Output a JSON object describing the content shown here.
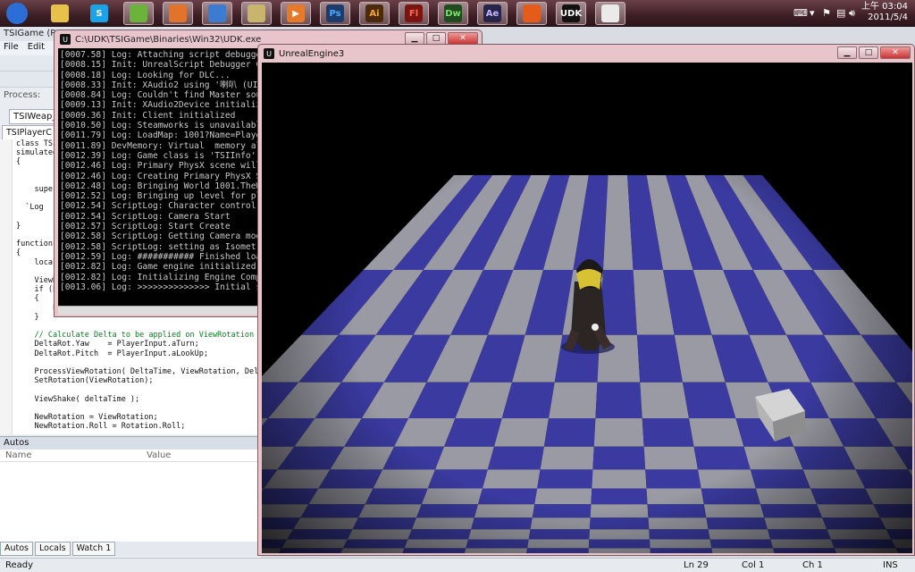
{
  "taskbar": {
    "apps": [
      {
        "name": "start",
        "label": ""
      },
      {
        "name": "explorer",
        "label": ""
      },
      {
        "name": "skype",
        "label": "S"
      },
      {
        "name": "contacts",
        "label": ""
      },
      {
        "name": "firefox",
        "label": ""
      },
      {
        "name": "window-manager",
        "label": ""
      },
      {
        "name": "notepad",
        "label": ""
      },
      {
        "name": "media-player",
        "label": "▶"
      },
      {
        "name": "photoshop",
        "label": "Ps"
      },
      {
        "name": "illustrator",
        "label": "Ai"
      },
      {
        "name": "flash",
        "label": "Fl"
      },
      {
        "name": "dreamweaver",
        "label": "Dw"
      },
      {
        "name": "after-effects",
        "label": "Ae"
      },
      {
        "name": "game-app",
        "label": ""
      },
      {
        "name": "udk",
        "label": "UDK"
      },
      {
        "name": "paint",
        "label": ""
      }
    ],
    "clock_time": "上午 03:04",
    "clock_date": "2011/5/4"
  },
  "vs": {
    "title": "TSIGame (R",
    "menu": [
      "File",
      "Edit"
    ],
    "process_label": "Process:",
    "tab_file": "TSIWeap_M",
    "tab_class": "TSIPlayerC",
    "code_lines": [
      "class TSI",
      "simulated",
      "{",
      "",
      "",
      "    supe",
      "",
      "  `Log",
      "",
      "}",
      "",
      "function",
      "{",
      "    local",
      "",
      "    ViewR",
      "    if (P",
      "    {",
      "        P",
      "    }",
      "",
      "    // Calculate Delta to be applied on ViewRotation",
      "    DeltaRot.Yaw    = PlayerInput.aTurn;",
      "    DeltaRot.Pitch  = PlayerInput.aLookUp;",
      "",
      "    ProcessViewRotation( DeltaTime, ViewRotation, DeltaRot );",
      "    SetRotation(ViewRotation);",
      "",
      "    ViewShake( deltaTime );",
      "",
      "    NewRotation = ViewRotation;",
      "    NewRotation.Roll = Rotation.Roll;"
    ],
    "autos_title": "Autos",
    "autos_col_name": "Name",
    "autos_col_value": "Value",
    "bottom_tabs": [
      "Autos",
      "Locals",
      "Watch 1"
    ]
  },
  "status": {
    "ready": "Ready",
    "ln": "Ln 29",
    "col": "Col 1",
    "ch": "Ch 1",
    "ins": "INS"
  },
  "console": {
    "title": "C:\\UDK\\TSIGame\\Binaries\\Win32\\UDK.exe",
    "lines": [
      "[0007.58] Log: Attaching script debugge",
      "[0008.15] Init: UnrealScript Debugger C",
      "[0008.18] Log: Looking for DLC...",
      "[0008.33] Init: XAudio2 using '喇叭 (UI",
      "[0008.84] Log: Couldn't find Master sou",
      "[0009.13] Init: XAudio2Device initializ",
      "[0009.36] Init: Client initialized",
      "[0010.50] Log: Steamworks is unavailabl",
      "[0011.79] Log: LoadMap: 1001?Name=Playe",
      "[0011.89] DevMemory: Virtual  memory al",
      "[0012.39] Log: Game class is 'TSIInfo'",
      "[0012.46] Log: Primary PhysX scene will",
      "[0012.46] Log: Creating Primary PhysX S",
      "[0012.48] Log: Bringing World 1001.TheW",
      "[0012.52] Log: Bringing up level for pl",
      "[0012.54] ScriptLog: Character control",
      "[0012.54] ScriptLog: Camera Start",
      "[0012.57] ScriptLog: Start Create",
      "[0012.58] ScriptLog: Getting Camera mod",
      "[0012.58] ScriptLog: setting as Isometr",
      "[0012.59] Log: ########### Finished loa",
      "[0012.82] Log: Game engine initialized",
      "[0012.82] Log: Initializing Engine Comp",
      "[0013.06] Log: >>>>>>>>>>>>>> Initial s"
    ],
    "minimize": "▁",
    "maximize": "□",
    "close": "✕"
  },
  "ue": {
    "title": "UnrealEngine3",
    "minimize": "▁",
    "maximize": "□",
    "close": "✕"
  },
  "colors": {
    "tile_dark": "#3a3aa0",
    "tile_light": "#9a9aa4",
    "window_frame": "#e8c4cb"
  }
}
